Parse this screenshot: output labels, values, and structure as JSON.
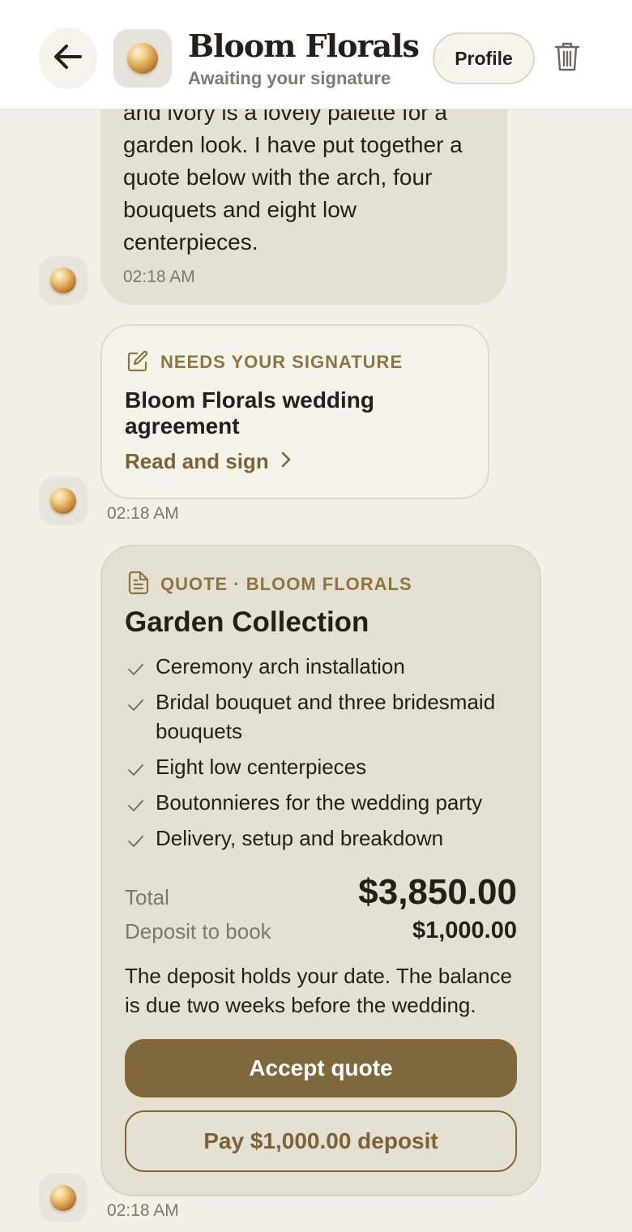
{
  "header": {
    "back_icon": "arrow-left-icon",
    "title": "Bloom Florals",
    "status": "Awaiting your signature",
    "profile_label": "Profile",
    "trash_icon": "trash-icon"
  },
  "messages": {
    "first": {
      "text": "and ivory is a lovely palette for a garden look. I have put together a quote below with the arch, four bouquets and eight low centerpieces.",
      "time": "02:18 AM"
    },
    "signature": {
      "icon": "edit-icon",
      "label": "NEEDS YOUR SIGNATURE",
      "title": "Bloom Florals wedding agreement",
      "link": "Read and sign",
      "time": "02:18 AM"
    },
    "quote": {
      "icon": "document-icon",
      "label": "QUOTE · BLOOM FLORALS",
      "title": "Garden Collection",
      "items": [
        "Ceremony arch installation",
        "Bridal bouquet and three bridesmaid bouquets",
        "Eight low centerpieces",
        "Boutonnieres for the wedding party",
        "Delivery, setup and breakdown"
      ],
      "total_label": "Total",
      "total_value": "$3,850.00",
      "deposit_label": "Deposit to book",
      "deposit_value": "$1,000.00",
      "note": "The deposit holds your date. The balance is due two weeks before the wedding.",
      "accept_label": "Accept quote",
      "pay_label": "Pay $1,000.00 deposit",
      "time": "02:18 AM"
    }
  },
  "colors": {
    "accent": "#7f683c",
    "background": "#f1f1e8",
    "bubble": "#e4e1d3"
  }
}
